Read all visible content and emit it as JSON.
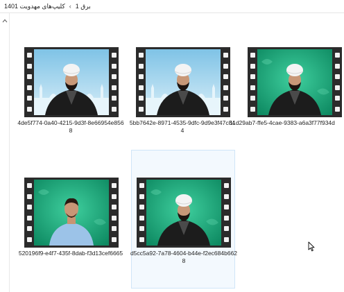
{
  "window": {
    "breadcrumb": [
      "کلیپ‌های مهدویت 1401",
      "برق 1"
    ],
    "breadcrumb_sep": "‹"
  },
  "files": [
    {
      "name_line1": "4de5f774-0a40-4215-9d3f-8e66954e856",
      "name_line2": "8",
      "background": "mosque-blue",
      "person": "cleric-white-turban"
    },
    {
      "name_line1": "5bb7642e-8971-4535-9dfc-9d9e3f47c84",
      "name_line2": "4",
      "background": "mosque-blue",
      "person": "cleric-white-turban"
    },
    {
      "name_line1": "11d29ab7-ffe5-4cae-9383-a6a3f77f934d",
      "name_line2": "",
      "background": "green",
      "person": "cleric-white-turban"
    },
    {
      "name_line1": "520196f9-e4f7-435f-8dab-f3d13cef6665",
      "name_line2": "",
      "background": "green",
      "person": "man-blue-shirt"
    },
    {
      "name_line1": "d5cc5a92-7a78-4604-b44e-f2ec684b662",
      "name_line2": "8",
      "background": "green",
      "person": "cleric-white-turban"
    }
  ],
  "selected_index": 4
}
